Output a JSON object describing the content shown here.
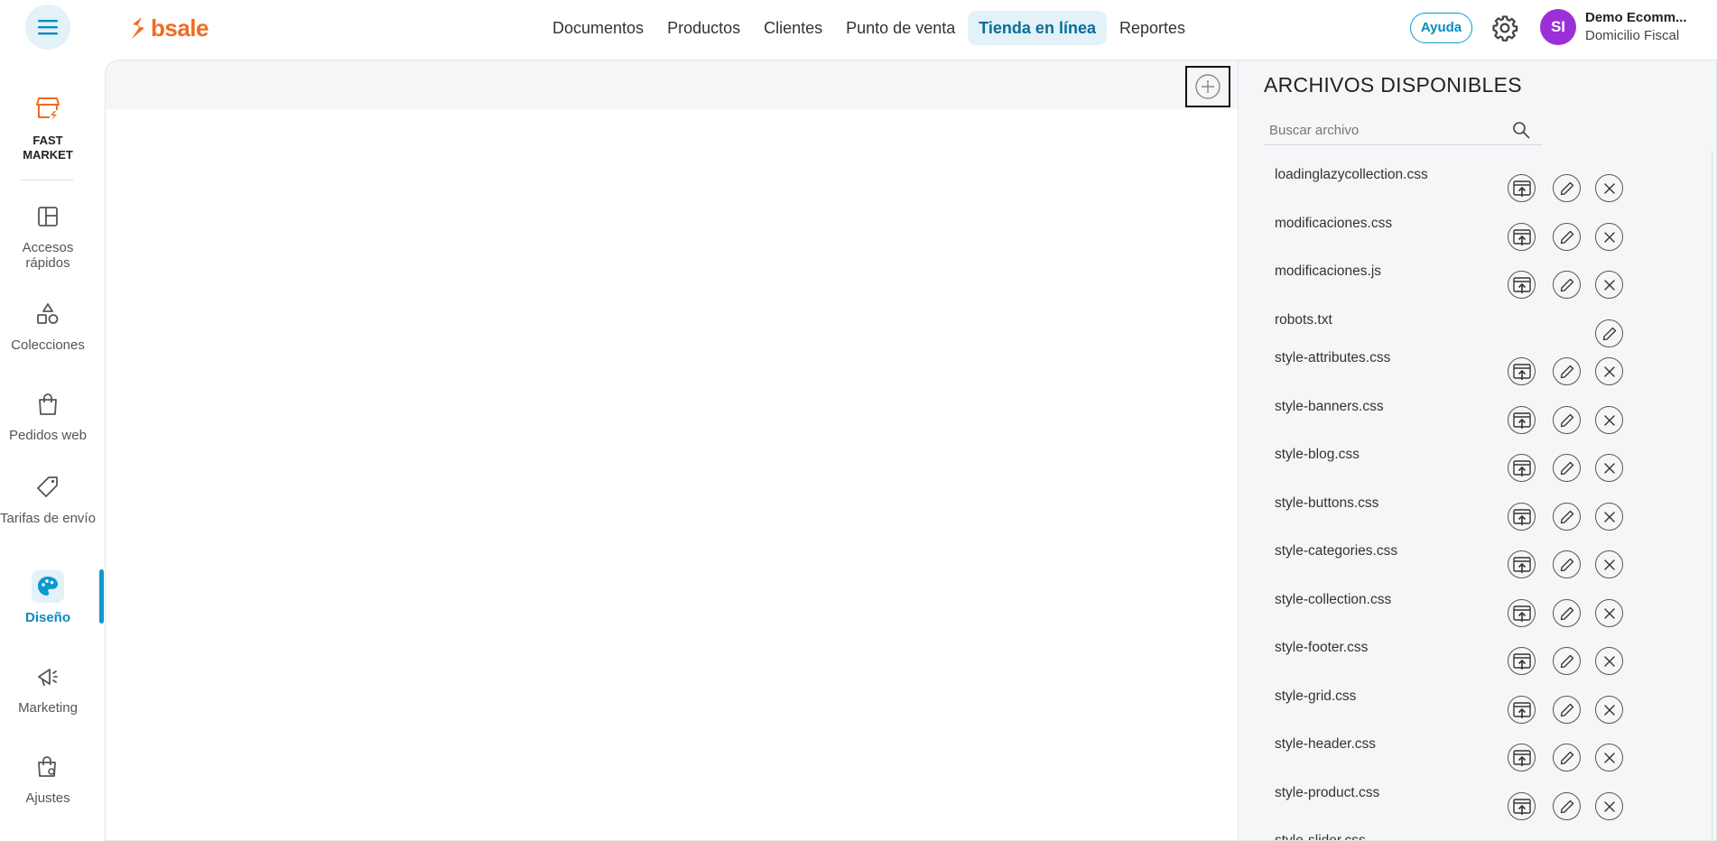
{
  "header": {
    "logo_text": "bsale",
    "nav": [
      {
        "label": "Documentos",
        "active": false
      },
      {
        "label": "Productos",
        "active": false
      },
      {
        "label": "Clientes",
        "active": false
      },
      {
        "label": "Punto de venta",
        "active": false
      },
      {
        "label": "Tienda en línea",
        "active": true
      },
      {
        "label": "Reportes",
        "active": false
      }
    ],
    "help_label": "Ayuda",
    "avatar_initials": "SI",
    "account_name": "Demo Ecomm...",
    "account_sub": "Domicilio Fiscal"
  },
  "sidebar": {
    "brand": {
      "line1": "FAST",
      "line2": "MARKET"
    },
    "items": [
      {
        "label": "Accesos rápidos",
        "icon": "layout-icon"
      },
      {
        "label": "Colecciones",
        "icon": "shapes-icon"
      },
      {
        "label": "Pedidos web",
        "icon": "shopping-bag-icon"
      },
      {
        "label": "Tarifas de envío",
        "icon": "tag-icon"
      },
      {
        "label": "Diseño",
        "icon": "palette-icon",
        "active": true
      },
      {
        "label": "Marketing",
        "icon": "megaphone-icon"
      },
      {
        "label": "Ajustes",
        "icon": "bag-gear-icon"
      }
    ]
  },
  "panel": {
    "title": "ARCHIVOS DISPONIBLES",
    "search_placeholder": "Buscar archivo",
    "files": [
      {
        "name": "loadinglazycollection.css",
        "publish": true,
        "delete": true
      },
      {
        "name": "modificaciones.css",
        "publish": true,
        "delete": true
      },
      {
        "name": "modificaciones.js",
        "publish": true,
        "delete": true
      },
      {
        "name": "robots.txt",
        "publish": false,
        "delete": false
      },
      {
        "name": "style-attributes.css",
        "publish": true,
        "delete": true
      },
      {
        "name": "style-banners.css",
        "publish": true,
        "delete": true
      },
      {
        "name": "style-blog.css",
        "publish": true,
        "delete": true
      },
      {
        "name": "style-buttons.css",
        "publish": true,
        "delete": true
      },
      {
        "name": "style-categories.css",
        "publish": true,
        "delete": true
      },
      {
        "name": "style-collection.css",
        "publish": true,
        "delete": true
      },
      {
        "name": "style-footer.css",
        "publish": true,
        "delete": true
      },
      {
        "name": "style-grid.css",
        "publish": true,
        "delete": true
      },
      {
        "name": "style-header.css",
        "publish": true,
        "delete": true
      },
      {
        "name": "style-product.css",
        "publish": true,
        "delete": true
      },
      {
        "name": "style-slider.css",
        "publish": true,
        "delete": true
      }
    ]
  },
  "colors": {
    "accent": "#0a9ad0",
    "brand_orange": "#f26b21",
    "avatar": "#9b2fd8"
  }
}
